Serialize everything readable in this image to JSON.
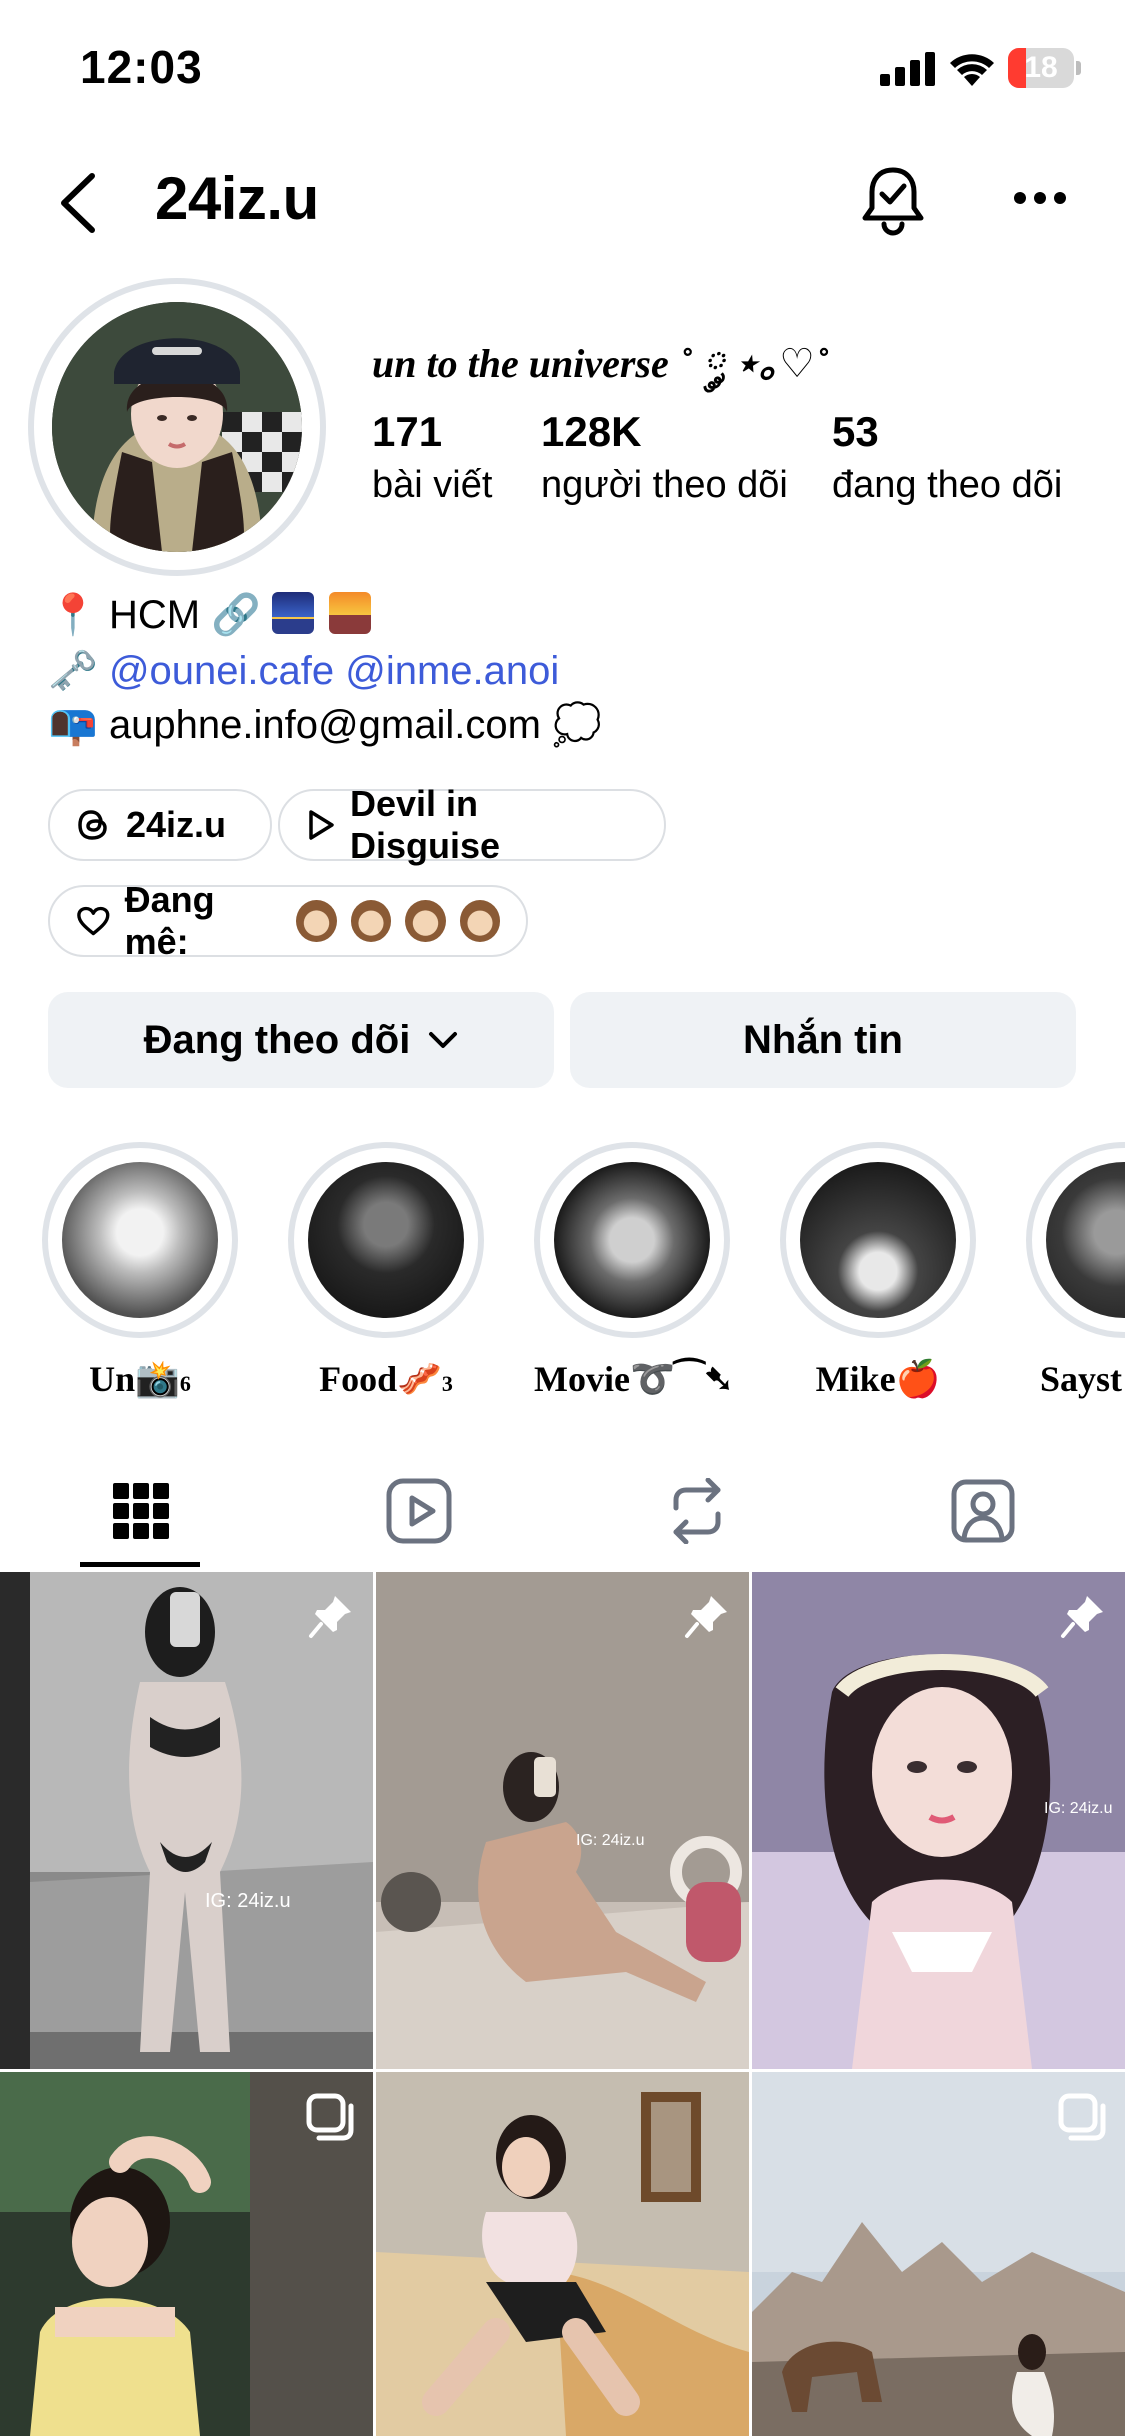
{
  "status_bar": {
    "time": "12:03",
    "battery": "18",
    "battery_color": "#ff3b30"
  },
  "header": {
    "username": "24iz.u"
  },
  "profile": {
    "bio_title": "un to the universe ˚ ༘ ⋆｡♡˚",
    "stats": [
      {
        "value": "171",
        "label": "bài viết"
      },
      {
        "value": "128K",
        "label": "người theo dõi"
      },
      {
        "value": "53",
        "label": "đang theo dõi"
      }
    ],
    "bio_lines": {
      "location": "HCM",
      "links": "@ounei.cafe @inme.anoi",
      "email": "auphne.info@gmail.com"
    }
  },
  "chips": {
    "threads": "24iz.u",
    "music": "Devil in Disguise",
    "heart_label": "Đang mê:"
  },
  "buttons": {
    "following": "Đang theo dõi",
    "message": "Nhắn tin"
  },
  "highlights": [
    {
      "label": "Un📸",
      "count": "6"
    },
    {
      "label": "Food🥓",
      "count": "3"
    },
    {
      "label": "Movie➰⁀➷",
      "count": ""
    },
    {
      "label": "Mike🍎",
      "count": ""
    },
    {
      "label": "Sayst",
      "count": ""
    }
  ],
  "tabs": [
    "grid-icon",
    "reels-icon",
    "repost-icon",
    "tagged-icon"
  ],
  "grid_watermarks": [
    "IG: 24iz.u",
    "IG: 24iz.u",
    "IG: 24iz.u"
  ],
  "colors": {
    "link": "#3d5bd9",
    "button_bg": "#eff2f5",
    "ring": "#dfe3e8"
  }
}
